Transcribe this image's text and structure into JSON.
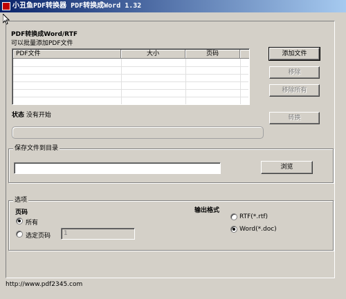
{
  "window": {
    "title": "小丑鱼PDF转换器 PDF转换成Word 1.32"
  },
  "header": {
    "heading": "PDF转换成Word/RTF",
    "subheading": "可以批量添加PDF文件"
  },
  "file_list": {
    "columns": [
      "PDF文件",
      "大小",
      "页码"
    ],
    "rows": []
  },
  "buttons": {
    "add_file": "添加文件",
    "remove": "移除",
    "remove_all": "移除所有",
    "convert": "转换",
    "browse": "浏览"
  },
  "status": {
    "label": "状态",
    "value": "没有开始",
    "progress": 0
  },
  "save": {
    "legend": "保存文件到目录",
    "path": ""
  },
  "options": {
    "legend": "选项",
    "pages_label": "页码",
    "all_pages": "所有",
    "selected_pages": "选定页码",
    "selected_pages_value": "1",
    "page_mode": "all",
    "format_label": "输出格式",
    "format_rtf": "RTF(*.rtf)",
    "format_word": "Word(*.doc)",
    "format": "word"
  },
  "footer": {
    "url": "http://www.pdf2345.com"
  }
}
